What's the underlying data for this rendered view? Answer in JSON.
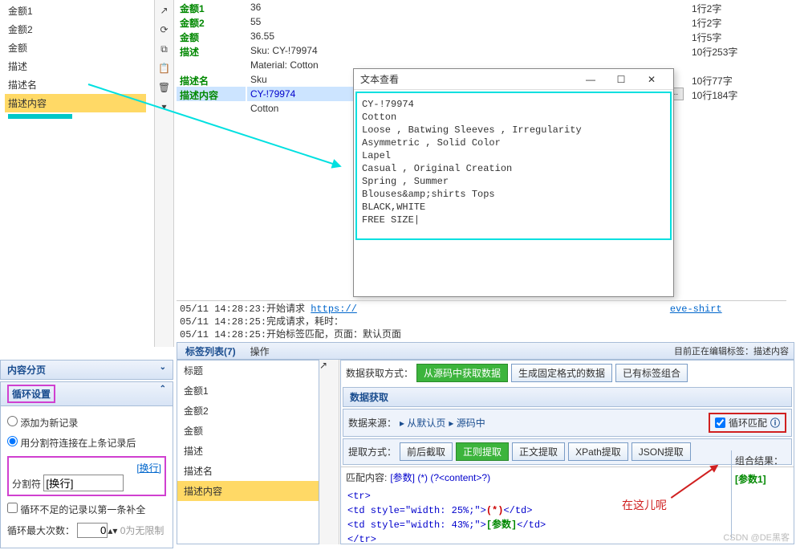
{
  "left_tree": [
    "金额1",
    "金额2",
    "金额",
    "描述",
    "描述名",
    "描述内容"
  ],
  "left_tree_sel": 5,
  "fields": [
    {
      "name": "金额1",
      "val": "36",
      "meta": "1行2字"
    },
    {
      "name": "金额2",
      "val": "55",
      "meta": "1行2字"
    },
    {
      "name": "金额",
      "val": "36.55",
      "meta": "1行5字"
    },
    {
      "name": "描述",
      "val": "Sku: CY-!79974",
      "meta": "10行253字"
    },
    {
      "name": "",
      "val": "Material: Cotton",
      "meta": ""
    },
    {
      "name": "描述名",
      "val": "Sku",
      "meta": "10行77字"
    },
    {
      "name": "描述内容",
      "val": "CY-!79974",
      "meta": "10行184字",
      "sel": true
    },
    {
      "name": "",
      "val": "Cotton",
      "meta": ""
    }
  ],
  "dialog": {
    "title": "文本查看",
    "lines": [
      "CY-!79974",
      "Cotton",
      "Loose , Batwing Sleeves , Irregularity",
      "Asymmetric , Solid Color",
      "Lapel",
      "Casual , Original Creation",
      "Spring , Summer",
      "Blouses&amp;shirts Tops",
      "BLACK,WHITE",
      "FREE SIZE|"
    ]
  },
  "log": {
    "l1_a": "05/11 14:28:23:开始请求 ",
    "l1_b": "https://",
    "l1_c": "eve-shirt",
    "l2": "05/11 14:28:25:完成请求，耗时：",
    "l3": "05/11 14:28:25:开始标签匹配，页面：默认页面"
  },
  "tabs": {
    "tab1": "标签列表(7)",
    "op": "操作",
    "right": "目前正在编辑标签：描述内容"
  },
  "bl": {
    "hdr1": "内容分页",
    "hdr2": "循环设置",
    "radio1": "添加为新记录",
    "radio2": "用分割符连接在上条记录后",
    "link": "[换行]",
    "lbl_split": "分割符",
    "split_val": "[换行]",
    "chk": "循环不足的记录以第一条补全",
    "lbl_max": "循环最大次数：",
    "max_val": "0",
    "hint": "0为无限制"
  },
  "bm_fields": [
    "标题",
    "金额1",
    "金额2",
    "金额",
    "描述",
    "描述名",
    "描述内容"
  ],
  "bm_sel": 6,
  "cfg": {
    "lbl_mode": "数据获取方式：",
    "btn_src": "从源码中获取数据",
    "btn_fixed": "生成固定格式的数据",
    "btn_combo": "已有标签组合",
    "hdr2": "数据获取",
    "lbl_src": "数据来源：",
    "crumb1": "从默认页",
    "crumb2": "源码中",
    "chk_loop": "循环匹配",
    "lbl_ext": "提取方式：",
    "btn_e1": "前后截取",
    "btn_e2": "正则提取",
    "btn_e3": "正文提取",
    "btn_e4": "XPath提取",
    "btn_e5": "JSON提取",
    "lbl_match": "匹配内容:",
    "match_expr": "[参数] (*) (?<content>?)",
    "code1": "<tr>",
    "code2a": "<td style=\"width: 25%;\">",
    "code2b": "(*)",
    "code2c": "</td>",
    "code3a": "<td style=\"width: 43%;\">",
    "code3b": "[参数]",
    "code3c": "</td>",
    "code4": "</tr>",
    "note": "在这儿呢",
    "combo_hdr": "组合结果：",
    "combo_val": "[参数1]"
  },
  "watermark": "CSDN @DE黑客"
}
